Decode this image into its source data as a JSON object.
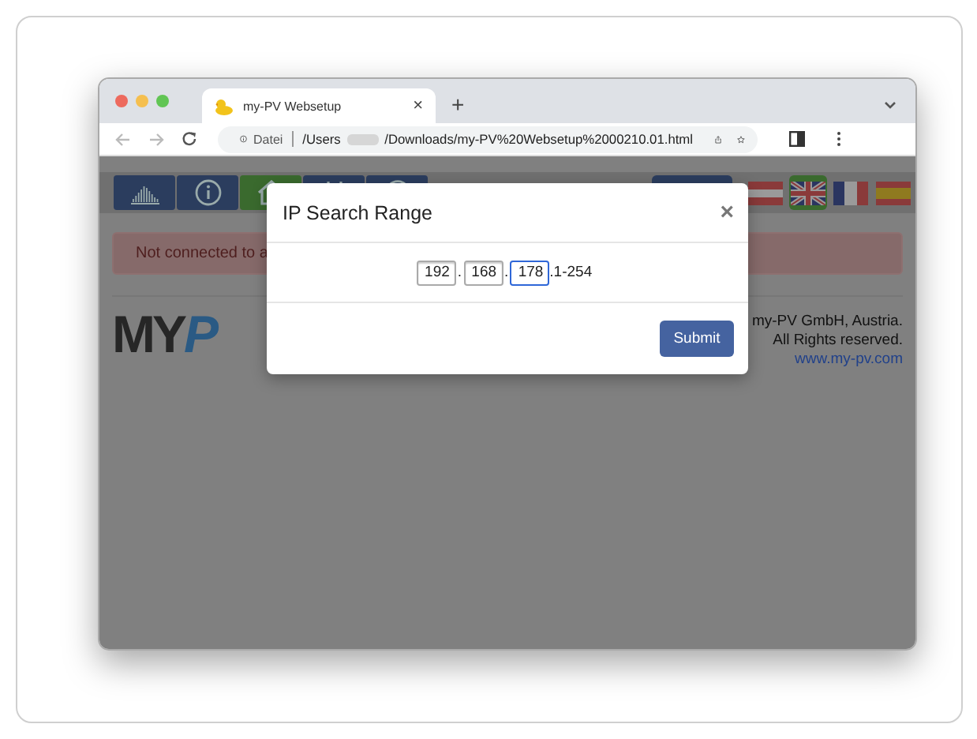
{
  "browser": {
    "tab": {
      "title": "my-PV Websetup",
      "close": "×"
    },
    "new_tab": "+",
    "address": {
      "scheme_label": "Datei",
      "path_start": "/Users",
      "path_end": "/Downloads/my-PV%20Websetup%2000210.01.html"
    }
  },
  "page": {
    "nav_buttons": [
      {
        "kind": "chart",
        "selected": false
      },
      {
        "kind": "info",
        "selected": false
      },
      {
        "kind": "home",
        "selected": true
      },
      {
        "kind": "tools",
        "selected": false
      },
      {
        "kind": "help",
        "selected": false
      }
    ],
    "flags": [
      {
        "kind": "at",
        "selected": false
      },
      {
        "kind": "uk",
        "selected": true
      },
      {
        "kind": "fr",
        "selected": false
      },
      {
        "kind": "es",
        "selected": false
      }
    ],
    "alert": "Not connected to a",
    "logo": {
      "part_1": "MY",
      "part_2": "P"
    },
    "footer": [
      "my-PV GmbH, Austria.",
      "All Rights reserved.",
      "www.my-pv.com"
    ]
  },
  "modal": {
    "title": "IP Search Range",
    "close": "×",
    "octets": [
      {
        "value": "192",
        "focused": false
      },
      {
        "value": "168",
        "focused": false
      },
      {
        "value": "178",
        "focused": true
      }
    ],
    "separators": [
      ".",
      "."
    ],
    "suffix": ".1-254",
    "submit": "Submit"
  }
}
